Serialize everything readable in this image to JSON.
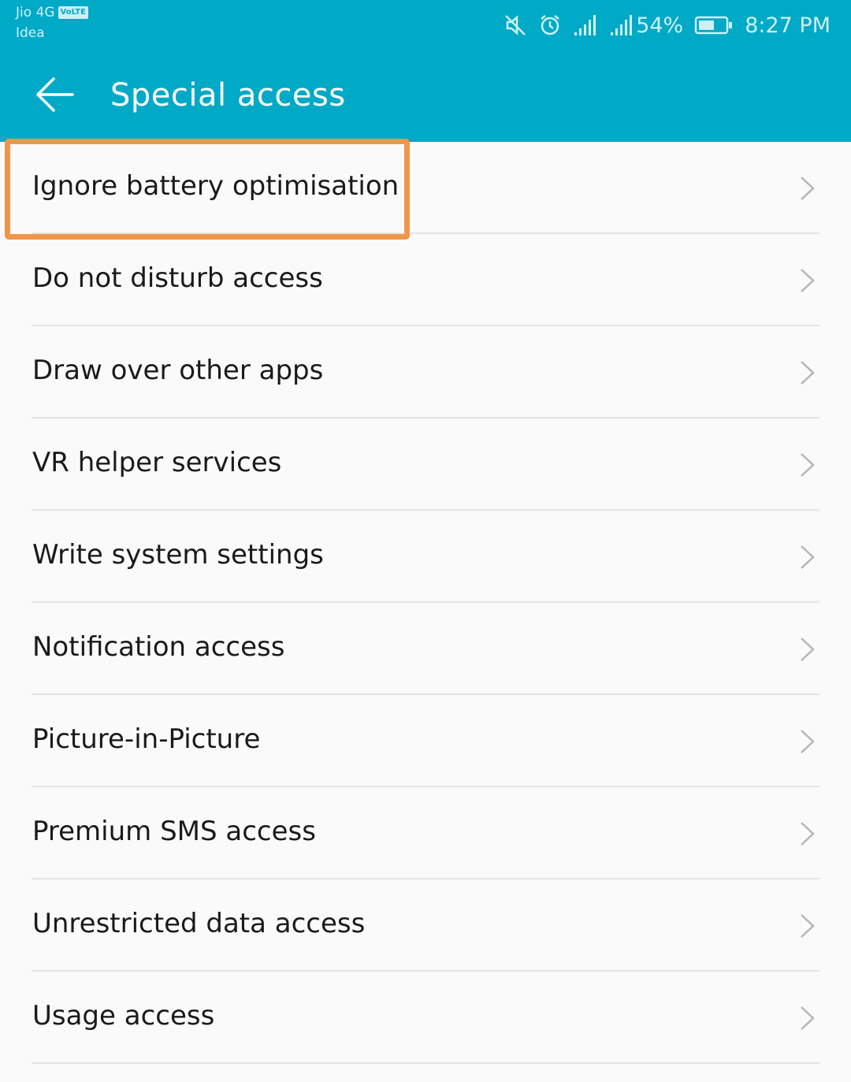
{
  "status_bar": {
    "carrier1": "Jio 4G",
    "volte_badge": "VoLTE",
    "carrier2": "Idea",
    "battery_percent": "54%",
    "time": "8:27 PM",
    "icons": [
      "mute-icon",
      "alarm-icon",
      "signal-icon",
      "signal-icon",
      "battery-icon"
    ]
  },
  "header": {
    "title": "Special access",
    "back_icon": "arrow-left-icon"
  },
  "list": {
    "items": [
      {
        "label": "Ignore battery optimisation"
      },
      {
        "label": "Do not disturb access"
      },
      {
        "label": "Draw over other apps"
      },
      {
        "label": "VR helper services"
      },
      {
        "label": "Write system settings"
      },
      {
        "label": "Notification access"
      },
      {
        "label": "Picture-in-Picture"
      },
      {
        "label": "Premium SMS access"
      },
      {
        "label": "Unrestricted data access"
      },
      {
        "label": "Usage access"
      }
    ],
    "chevron_icon": "chevron-right-icon"
  },
  "colors": {
    "appbar": "#00a9c6",
    "background": "#fafafa",
    "highlight": "#f0964a",
    "text": "#1a1a1a"
  },
  "annotation": {
    "highlighted_item": "Ignore battery optimisation"
  }
}
